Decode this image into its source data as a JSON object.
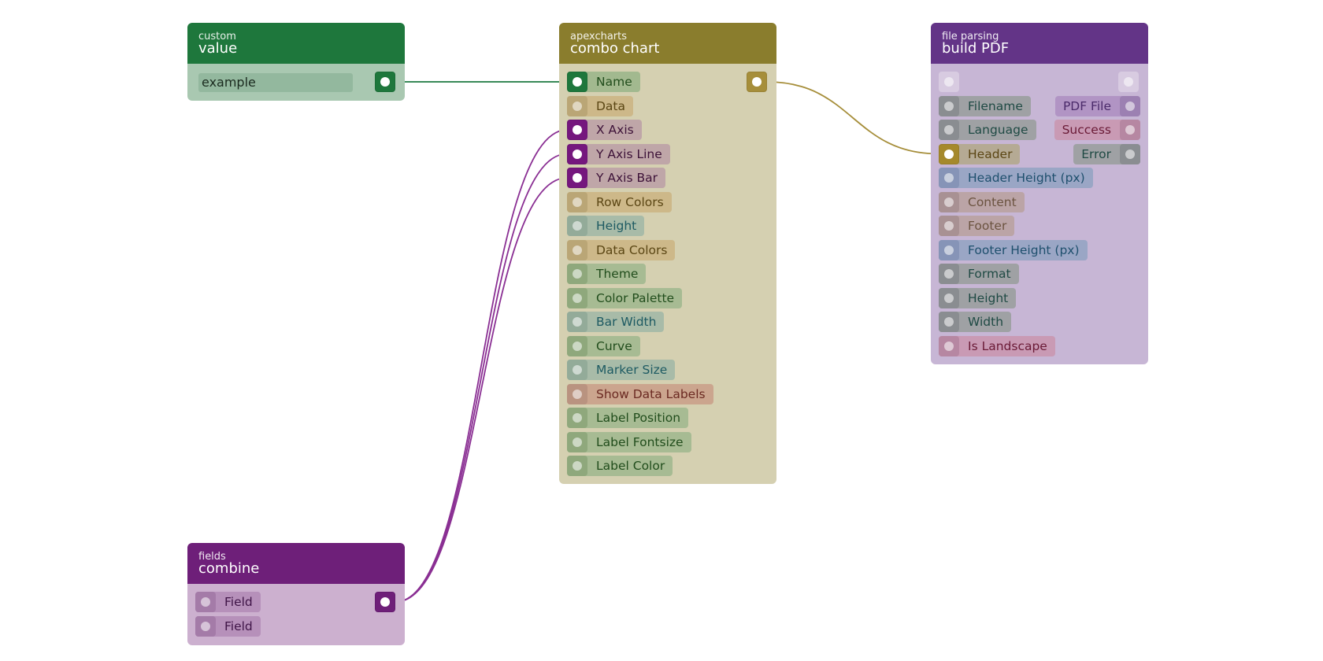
{
  "colors": {
    "canvas": "#ffffff",
    "wire_purple": "#8a2f93",
    "wire_green": "#1c7a40",
    "wire_gold": "#a68e3a"
  },
  "value_node": {
    "category": "custom",
    "title": "value",
    "field_value": "example",
    "header_color": "#1e773c",
    "body_color": "#a9c8b1"
  },
  "combine_node": {
    "category": "fields",
    "title": "combine",
    "fields": [
      "Field",
      "Field"
    ],
    "header_color": "#6e1f79",
    "body_color": "#ccb0cf"
  },
  "combo_node": {
    "category": "apexcharts",
    "title": "combo chart",
    "inputs": [
      "Name",
      "Data",
      "X Axis",
      "Y Axis Line",
      "Y Axis Bar",
      "Row Colors",
      "Height",
      "Data Colors",
      "Theme",
      "Color Palette",
      "Bar Width",
      "Curve",
      "Marker Size",
      "Show Data Labels",
      "Label Position",
      "Label Fontsize",
      "Label Color"
    ],
    "header_color": "#8a7d2d",
    "body_color": "#d5d0b1"
  },
  "pdf_node": {
    "category": "file parsing",
    "title": "build PDF",
    "inputs": [
      "Filename",
      "Language",
      "Header",
      "Header Height (px)",
      "Content",
      "Footer",
      "Footer Height (px)",
      "Format",
      "Height",
      "Width",
      "Is Landscape"
    ],
    "outputs": [
      "PDF File",
      "Success",
      "Error"
    ],
    "header_color": "#633487",
    "body_color": "#c7b6d5"
  }
}
